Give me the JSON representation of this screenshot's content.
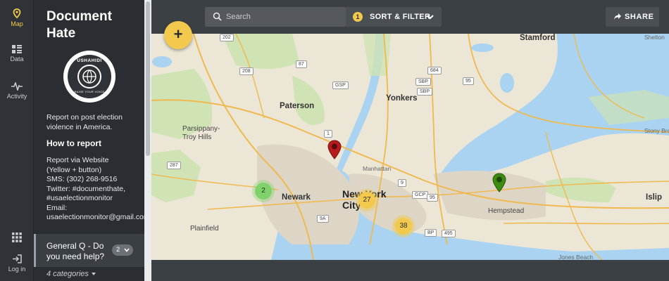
{
  "rail": {
    "map_label": "Map",
    "data_label": "Data",
    "activity_label": "Activity",
    "login_label": "Log in",
    "accent": "#f2c94c"
  },
  "sidebar": {
    "title": "Document Hate",
    "logo": {
      "wordmark": "USHAHIDI",
      "tagline": "RAISE YOUR VOICE"
    },
    "description": "Report on post election violence in America.",
    "how_to_heading": "How to report",
    "how_to_lines": [
      "Report via Website",
      "(Yellow + button)",
      "SMS: (302) 268-9516",
      "Twitter: #documenthate,",
      "#usaelectionmonitor",
      "Email:",
      "usaelectionmonitor@gmail.com"
    ],
    "question": {
      "label": "General Q - Do you need help?",
      "count": "2"
    },
    "categories_label": "4 categories"
  },
  "topbar": {
    "search_placeholder": "Search",
    "filter_count": "1",
    "filter_label": "SORT & FILTER",
    "share_label": "SHARE"
  },
  "fab_label": "+",
  "map": {
    "places": [
      {
        "name": "Stamford",
        "kind": "city"
      },
      {
        "name": "Paterson",
        "kind": "city"
      },
      {
        "name": "Yonkers",
        "kind": "city"
      },
      {
        "name": "Parsippany-Troy Hills",
        "kind": "city"
      },
      {
        "name": "Newark",
        "kind": "city"
      },
      {
        "name": "New York City",
        "kind": "major"
      },
      {
        "name": "Hempstead",
        "kind": "city"
      },
      {
        "name": "Plainfield",
        "kind": "city"
      },
      {
        "name": "Manhattan",
        "kind": "district"
      },
      {
        "name": "Shelton",
        "kind": "town"
      },
      {
        "name": "Stony Brook",
        "kind": "town"
      },
      {
        "name": "Islip",
        "kind": "city"
      },
      {
        "name": "Jones Beach",
        "kind": "town"
      }
    ],
    "highway_shields": [
      "202",
      "208",
      "87",
      "GSP",
      "SBP",
      "684",
      "SBP",
      "95",
      "287",
      "1",
      "9",
      "GCP",
      "95",
      "BP",
      "495",
      "9A"
    ],
    "clusters": [
      {
        "count": "2",
        "color": "#7fd26a"
      },
      {
        "count": "27",
        "color": "#f2c94c"
      },
      {
        "count": "38",
        "color": "#f2c94c"
      }
    ],
    "markers": [
      {
        "color": "#b71c1c"
      },
      {
        "color": "#3d8b12"
      }
    ],
    "colors": {
      "land": "#ece6d6",
      "water": "#a9d3f0",
      "green": "#cfe3b4",
      "urban": "#ddd6c6",
      "road": "#f0b94f"
    }
  }
}
